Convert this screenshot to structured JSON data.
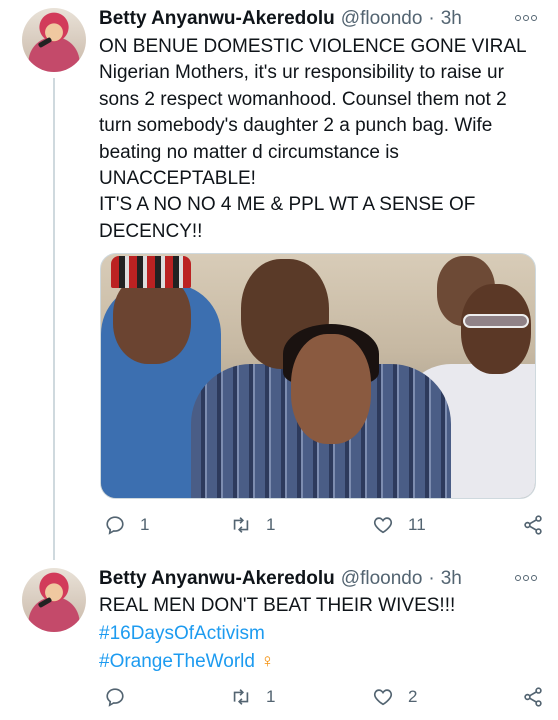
{
  "tweets": [
    {
      "author_name": "Betty Anyanwu-Akeredolu",
      "handle": "@floondo",
      "separator": "·",
      "time": "3h",
      "lines": [
        "ON BENUE DOMESTIC VIOLENCE GONE VIRAL",
        "Nigerian Mothers, it's ur responsibility to raise ur",
        "sons 2 respect womanhood. Counsel them not 2",
        "turn somebody's daughter 2 a punch bag. Wife",
        "beating no matter d circumstance is",
        "UNACCEPTABLE!",
        "IT'S A NO NO 4 ME & PPL WT A SENSE OF",
        "DECENCY!!"
      ],
      "replies": "1",
      "retweets": "1",
      "likes": "11"
    },
    {
      "author_name": "Betty Anyanwu-Akeredolu",
      "handle": "@floondo",
      "separator": "·",
      "time": "3h",
      "line1": "REAL MEN DON'T BEAT THEIR WIVES!!!",
      "hashtag1": "#16DaysOfActivism",
      "hashtag2": "#OrangeTheWorld",
      "emoji": "♀",
      "replies": "",
      "retweets": "1",
      "likes": "2"
    }
  ],
  "icons": {
    "reply": "reply-icon",
    "retweet": "retweet-icon",
    "like": "heart-icon",
    "share": "share-icon",
    "more": "more-icon"
  },
  "colors": {
    "link": "#1d9bf0",
    "secondary": "#536471",
    "text": "#0f1419"
  }
}
